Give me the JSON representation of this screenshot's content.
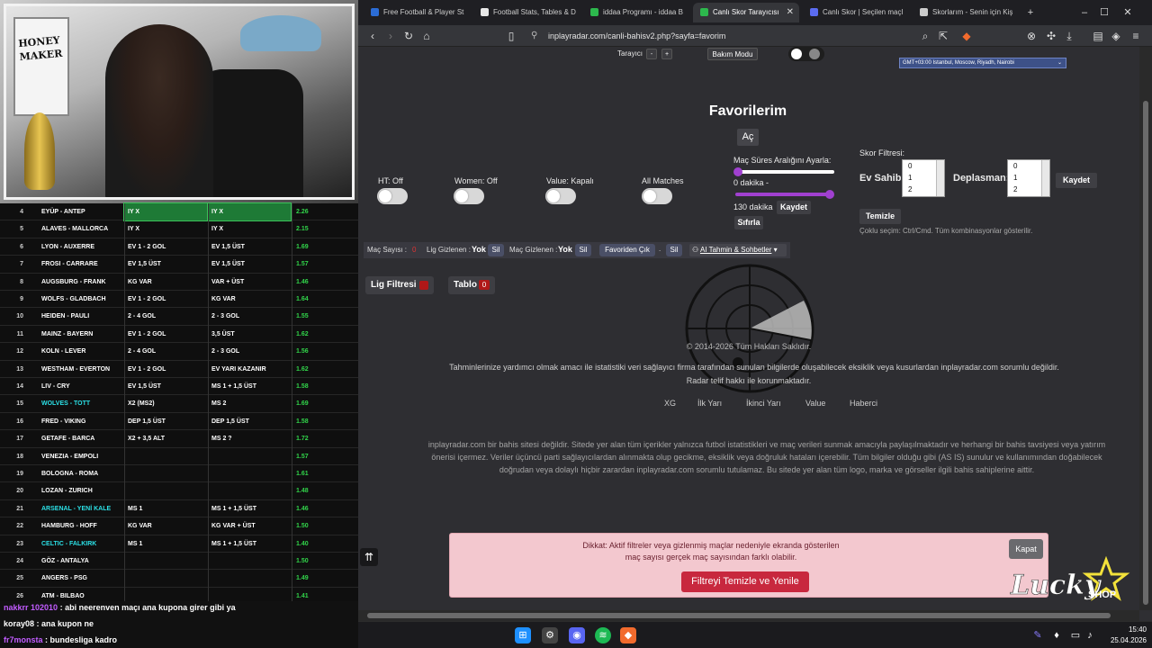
{
  "stream": {
    "poster_text": [
      "HONEY",
      "MAKER"
    ],
    "predictions": [
      {
        "no": "4",
        "match": "EYÜP - ANTEP",
        "p1": "IY X",
        "p2": "IY X",
        "odd": "2.26",
        "hl_match": false,
        "hl_cells": true
      },
      {
        "no": "5",
        "match": "ALAVES - MALLORCA",
        "p1": "IY X",
        "p2": "IY X",
        "odd": "2.15",
        "hl_match": false,
        "hl_cells": false
      },
      {
        "no": "6",
        "match": "LYON - AUXERRE",
        "p1": "EV 1 - 2 GOL",
        "p2": "EV 1,5 ÜST",
        "odd": "1.69",
        "hl_match": false,
        "hl_cells": false
      },
      {
        "no": "7",
        "match": "FROSI - CARRARE",
        "p1": "EV 1,5 ÜST",
        "p2": "EV 1,5 ÜST",
        "odd": "1.57",
        "hl_match": false,
        "hl_cells": false
      },
      {
        "no": "8",
        "match": "AUGSBURG - FRANK",
        "p1": "KG VAR",
        "p2": "VAR + ÜST",
        "odd": "1.46",
        "hl_match": false,
        "hl_cells": false
      },
      {
        "no": "9",
        "match": "WOLFS - GLADBACH",
        "p1": "EV 1 - 2 GOL",
        "p2": "KG VAR",
        "odd": "1.64",
        "hl_match": false,
        "hl_cells": false
      },
      {
        "no": "10",
        "match": "HEIDEN - PAULI",
        "p1": "2 - 4 GOL",
        "p2": "2 - 3 GOL",
        "odd": "1.55",
        "hl_match": false,
        "hl_cells": false
      },
      {
        "no": "11",
        "match": "MAINZ - BAYERN",
        "p1": "EV 1 - 2 GOL",
        "p2": "3,5 ÜST",
        "odd": "1.62",
        "hl_match": false,
        "hl_cells": false
      },
      {
        "no": "12",
        "match": "KOLN - LEVER",
        "p1": "2 - 4 GOL",
        "p2": "2 - 3 GOL",
        "odd": "1.56",
        "hl_match": false,
        "hl_cells": false
      },
      {
        "no": "13",
        "match": "WESTHAM - EVERTON",
        "p1": "EV 1 - 2 GOL",
        "p2": "EV YARI KAZANIR",
        "odd": "1.62",
        "hl_match": false,
        "hl_cells": false
      },
      {
        "no": "14",
        "match": "LIV - CRY",
        "p1": "EV 1,5 ÜST",
        "p2": "MS 1 + 1,5 ÜST",
        "odd": "1.58",
        "hl_match": false,
        "hl_cells": false
      },
      {
        "no": "15",
        "match": "WOLVES - TOTT",
        "p1": "X2 (MS2)",
        "p2": "MS 2",
        "odd": "1.69",
        "hl_match": true,
        "hl_cells": false
      },
      {
        "no": "16",
        "match": "FRED - VIKING",
        "p1": "DEP 1,5 ÜST",
        "p2": "DEP 1,5 ÜST",
        "odd": "1.58",
        "hl_match": false,
        "hl_cells": false
      },
      {
        "no": "17",
        "match": "GETAFE - BARCA",
        "p1": "X2 + 3,5 ALT",
        "p2": "MS 2 ?",
        "odd": "1.72",
        "hl_match": false,
        "hl_cells": false
      },
      {
        "no": "18",
        "match": "VENEZIA - EMPOLI",
        "p1": "",
        "p2": "",
        "odd": "1.57",
        "hl_match": false,
        "hl_cells": false
      },
      {
        "no": "19",
        "match": "BOLOGNA - ROMA",
        "p1": "",
        "p2": "",
        "odd": "1.61",
        "hl_match": false,
        "hl_cells": false
      },
      {
        "no": "20",
        "match": "LOZAN - ZURICH",
        "p1": "",
        "p2": "",
        "odd": "1.48",
        "hl_match": false,
        "hl_cells": false
      },
      {
        "no": "21",
        "match": "ARSENAL - YENİ KALE",
        "p1": "MS 1",
        "p2": "MS 1 + 1,5 ÜST",
        "odd": "1.46",
        "hl_match": true,
        "hl_cells": false
      },
      {
        "no": "22",
        "match": "HAMBURG - HOFF",
        "p1": "KG VAR",
        "p2": "KG VAR + ÜST",
        "odd": "1.50",
        "hl_match": false,
        "hl_cells": false
      },
      {
        "no": "23",
        "match": "CELTIC - FALKIRK",
        "p1": "MS 1",
        "p2": "MS 1 + 1,5 ÜST",
        "odd": "1.40",
        "hl_match": true,
        "hl_cells": false
      },
      {
        "no": "24",
        "match": "GÖZ - ANTALYA",
        "p1": "",
        "p2": "",
        "odd": "1.50",
        "hl_match": false,
        "hl_cells": false
      },
      {
        "no": "25",
        "match": "ANGERS - PSG",
        "p1": "",
        "p2": "",
        "odd": "1.49",
        "hl_match": false,
        "hl_cells": false
      },
      {
        "no": "26",
        "match": "ATM - BILBAO",
        "p1": "",
        "p2": "",
        "odd": "1.41",
        "hl_match": false,
        "hl_cells": false
      }
    ],
    "chat": [
      {
        "user": "nakkrr 102010",
        "msg": ": abi neerenven maçı ana kupona girer gibi ya"
      },
      {
        "user": "koray08",
        "msg": ": ana kupon ne"
      },
      {
        "user": "fr7monsta",
        "msg": ": bundesliga kadro"
      }
    ]
  },
  "browser": {
    "tabs": [
      {
        "label": "Free Football & Player St",
        "active": false,
        "icon_color": "#2b6cd6"
      },
      {
        "label": "Football Stats, Tables & D",
        "active": false,
        "icon_color": "#e8e8e8"
      },
      {
        "label": "iddaa Programı - iddaa B",
        "active": false,
        "icon_color": "#2db84d"
      },
      {
        "label": "Canlı Skor Tarayıcısı",
        "active": true,
        "icon_color": "#2db84d"
      },
      {
        "label": "Canlı Skor | Seçilen maçl",
        "active": false,
        "icon_color": "#5b6cf0"
      },
      {
        "label": "Skorlarım - Senin için Kiş",
        "active": false,
        "icon_color": "#cccccc"
      }
    ],
    "new_tab": "+",
    "url": "inplayradar.com/canli-bahisv2.php?sayfa=favorim",
    "window_controls": [
      "–",
      "☐",
      "✕"
    ]
  },
  "page": {
    "top_bar": {
      "tarayici_label": "Tarayıcı",
      "minus": "-",
      "plus": "+",
      "bakim_modu": "Bakım Modu",
      "timezone": "GMT+03:00 Istanbul, Moscow, Riyadh, Nairobi",
      "theme_icon": "moon-icon"
    },
    "title": "Favorilerim",
    "open_button": "Aç",
    "toggles": [
      {
        "label": "HT: Off"
      },
      {
        "label": "Women: Off"
      },
      {
        "label": "Value: Kapalı"
      },
      {
        "label": "All Matches"
      }
    ],
    "duration": {
      "label": "Maç Süres Aralığını Ayarla:",
      "min_label": "0 dakika -",
      "max_label": "130 dakika",
      "save": "Kaydet",
      "reset": "Sıfırla",
      "slider_min": 0,
      "slider_max": 130
    },
    "score_filter": {
      "label": "Skor Filtresi:",
      "home_label": "Ev Sahibi:",
      "away_label": "Deplasman:",
      "home_options": [
        "0",
        "1",
        "2"
      ],
      "away_options": [
        "0",
        "1",
        "2"
      ],
      "save": "Kaydet",
      "clear": "Temizle",
      "hint": "Çoklu seçim: Ctrl/Cmd. Tüm kombinasyonlar gösterilir."
    },
    "filter_bar": {
      "count_label": "Maç Sayısı :",
      "count_value": "0",
      "hidden_leagues": "Lig Gizlenen :",
      "hidden_leagues_value": "Yok",
      "delete1": "Sil",
      "hidden_matches": "Maç Gizlenen :",
      "hidden_matches_value": "Yok",
      "delete2": "Sil",
      "favorites_out": "Favoriden Çık",
      "dot": ".",
      "delete3": "Sil",
      "ai_menu": "AI Tahmin & Sohbetler"
    },
    "lig_filtresi": "Lig Filtresi",
    "tablo": "Tablo",
    "tablo_count": "0",
    "copyright": "© 2014-2026 Tüm Hakları Saklıdır.",
    "disclaimer1": "Tahminlerinize yardımcı olmak amacı ile istatistiki veri sağlayıcı firma tarafından sunulan bilgilerde oluşabilecek eksiklik veya kusurlardan inplayradar.com sorumlu değildir.",
    "disclaimer2": "Radar telif hakkı ile korunmaktadır.",
    "footer_links": [
      "XG",
      "İlk Yarı",
      "İkinci Yarı",
      "Value",
      "Haberci"
    ],
    "footer_paragraph": "inplayradar.com bir bahis sitesi değildir. Sitede yer alan tüm içerikler yalnızca futbol istatistikleri ve maç verileri sunmak amacıyla paylaşılmaktadır ve herhangi bir bahis tavsiyesi veya yatırım önerisi içermez. Veriler üçüncü parti sağlayıcılardan alınmakta olup gecikme, eksiklik veya doğruluk hataları içerebilir. Tüm bilgiler olduğu gibi (AS IS) sunulur ve kullanımından doğabilecek doğrudan veya dolaylı hiçbir zarardan inplayradar.com sorumlu tutulamaz. Bu sitede yer alan tüm logo, marka ve görseller ilgili bahis sahiplerine aittir.",
    "scroll_top": "⇈",
    "alert": {
      "text1": "Dikkat: Aktif filtreler veya gizlenmiş maçlar nedeniyle ekranda gösterilen",
      "text2": "maç sayısı gerçek maç sayısından farklı olabilir.",
      "close": "Kapat",
      "action": "Filtreyi Temizle ve Yenile"
    }
  },
  "overlay": {
    "logo_text": "Lucky",
    "logo_sub": "SHOP"
  },
  "taskbar": {
    "time": "15:40",
    "date": "25.04.2026"
  }
}
